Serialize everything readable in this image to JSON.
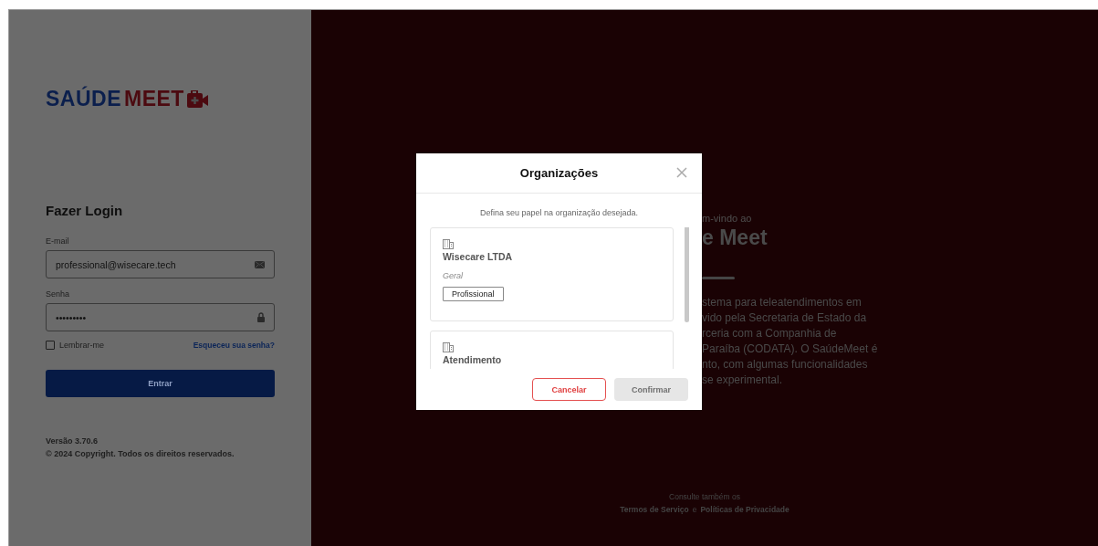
{
  "login": {
    "logo": {
      "part_1": "SAÚDE",
      "part_2": "MEET"
    },
    "title": "Fazer Login",
    "email": {
      "label": "E-mail",
      "value": "professional@wisecare.tech"
    },
    "password": {
      "label": "Senha",
      "value": "•••••••••"
    },
    "remember": {
      "label": "Lembrar-me",
      "checked": false
    },
    "forgot_link": "Esqueceu sua senha?",
    "submit": "Entrar",
    "version": "Versão 3.70.6",
    "copyright": "© 2024 Copyright. Todos os direitos reservados."
  },
  "welcome": {
    "subtitle": "m-vindo ao",
    "title": "e Meet",
    "lines": [
      "stema para teleatendimentos em",
      "vido pela Secretaria de Estado da",
      "rceria com a Companhia de",
      "Paraíba (CODATA). O SaúdeMeet é",
      "nto, com algumas funcionalidades",
      "se experimental."
    ],
    "footer": {
      "text": "Consulte também os",
      "terms_link": "Termos de Serviço",
      "conjunction": "e",
      "privacy_link": "Políticas de Privacidade"
    }
  },
  "modal": {
    "title": "Organizações",
    "instruction": "Defina seu papel na organização desejada.",
    "organizations": [
      {
        "name": "Wisecare LTDA",
        "category": "Geral",
        "roles": [
          "Profissional"
        ]
      },
      {
        "name": "Atendimento"
      }
    ],
    "cancel": "Cancelar",
    "confirm": {
      "label": "Confirmar",
      "disabled": true
    }
  }
}
